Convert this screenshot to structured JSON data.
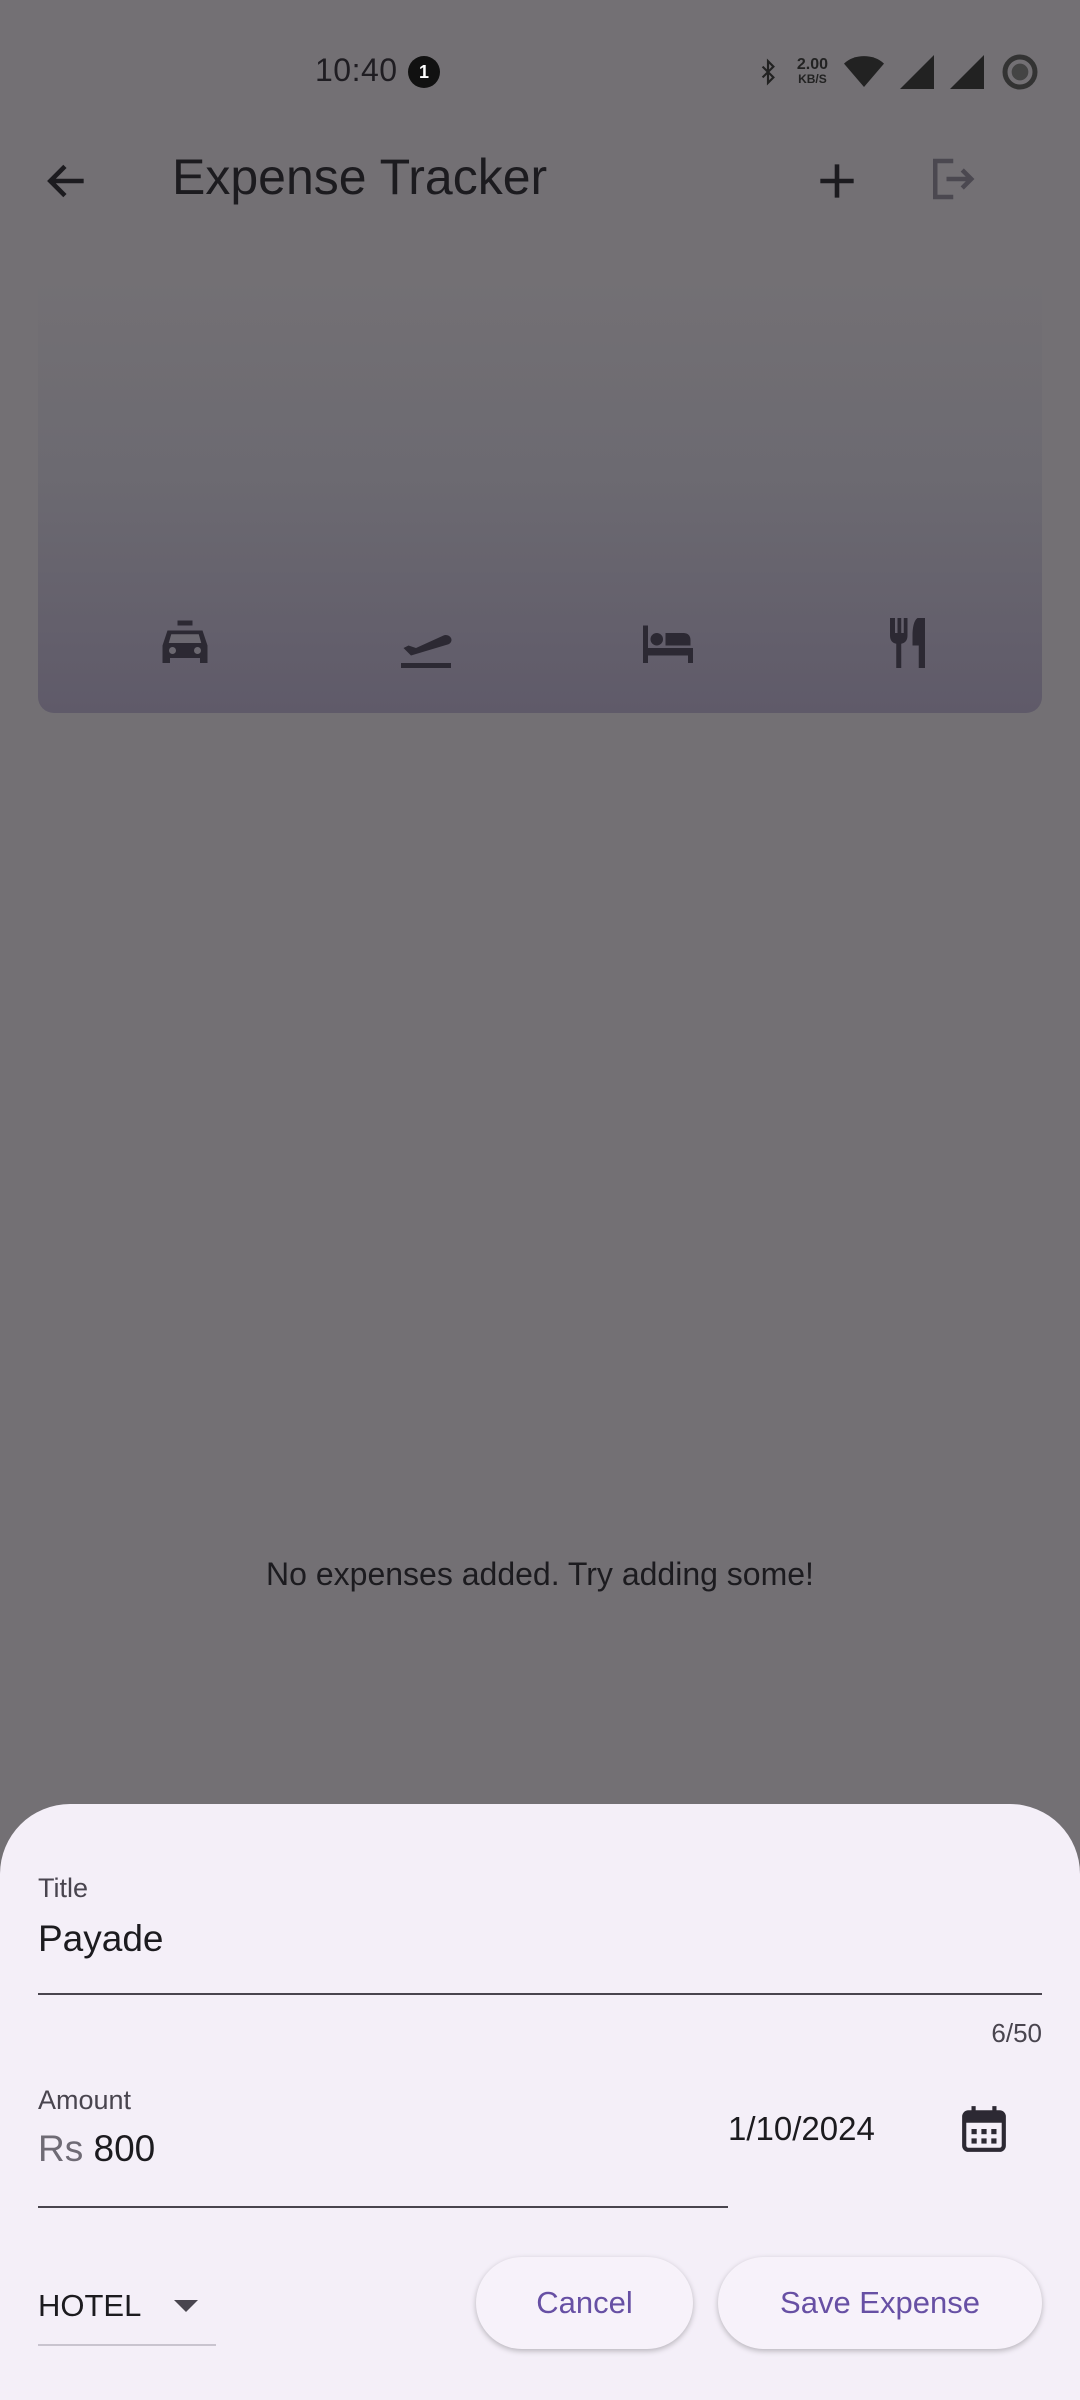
{
  "status_bar": {
    "time": "10:40",
    "notification_count": "1",
    "net_speed_value": "2.00",
    "net_speed_unit": "KB/S"
  },
  "app_bar": {
    "title": "Expense Tracker"
  },
  "categories": [
    "taxi-icon",
    "flight-takeoff-icon",
    "hotel-bed-icon",
    "restaurant-icon"
  ],
  "empty_state": "No expenses added. Try adding some!",
  "sheet": {
    "title_label": "Title",
    "title_value": "Payade",
    "char_counter": "6/50",
    "amount_label": "Amount",
    "amount_prefix": "Rs",
    "amount_value": "800",
    "date_value": "1/10/2024",
    "category_value": "HOTEL",
    "cancel_label": "Cancel",
    "save_label": "Save Expense"
  },
  "colors": {
    "scrim": "#737074",
    "sheet_bg": "#f4eff8",
    "accent": "#6750a4"
  }
}
